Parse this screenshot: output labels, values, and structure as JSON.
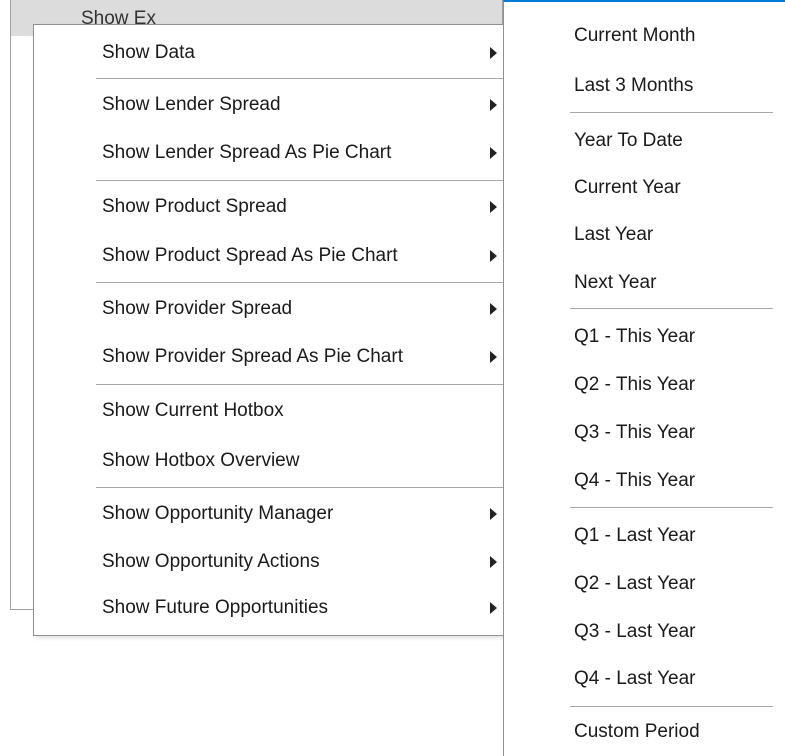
{
  "background": {
    "title_text": "Show Ex"
  },
  "menu": {
    "items": [
      {
        "label": "Show Data",
        "submenu": true
      },
      {
        "label": "Show Lender Spread",
        "submenu": true
      },
      {
        "label": "Show Lender Spread As Pie Chart",
        "submenu": true
      },
      {
        "label": "Show Product Spread",
        "submenu": true
      },
      {
        "label": "Show Product Spread As Pie Chart",
        "submenu": true
      },
      {
        "label": "Show Provider Spread",
        "submenu": true
      },
      {
        "label": "Show Provider Spread As Pie Chart",
        "submenu": true
      },
      {
        "label": "Show Current Hotbox",
        "submenu": false
      },
      {
        "label": "Show Hotbox Overview",
        "submenu": false
      },
      {
        "label": "Show Opportunity Manager",
        "submenu": true
      },
      {
        "label": "Show Opportunity Actions",
        "submenu": true
      },
      {
        "label": "Show Future Opportunities",
        "submenu": true
      }
    ]
  },
  "submenu": {
    "items": [
      {
        "label": "Current Month"
      },
      {
        "label": "Last 3 Months"
      },
      {
        "label": "Year To Date"
      },
      {
        "label": "Current Year"
      },
      {
        "label": "Last Year"
      },
      {
        "label": "Next Year"
      },
      {
        "label": "Q1 - This Year"
      },
      {
        "label": "Q2 - This Year"
      },
      {
        "label": "Q3 - This Year"
      },
      {
        "label": "Q4 - This Year"
      },
      {
        "label": "Q1 - Last Year"
      },
      {
        "label": "Q2 - Last Year"
      },
      {
        "label": "Q3 - Last Year"
      },
      {
        "label": "Q4 - Last Year"
      },
      {
        "label": "Custom Period"
      }
    ]
  },
  "colors": {
    "accent": "#0078d7",
    "separator": "#a8a8a8",
    "menu_border": "#8f8f8f"
  }
}
